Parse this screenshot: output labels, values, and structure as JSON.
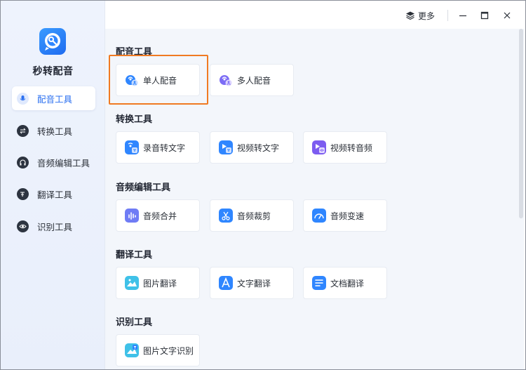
{
  "app": {
    "name": "秒转配音",
    "logo_icon": "microphone-chat-icon"
  },
  "titlebar": {
    "more_label": "更多",
    "more_icon": "layers-icon",
    "minimize_icon": "minimize-icon",
    "maximize_icon": "maximize-icon",
    "close_icon": "close-icon"
  },
  "sidebar": {
    "items": [
      {
        "label": "配音工具",
        "icon": "microphone-icon",
        "active": true
      },
      {
        "label": "转换工具",
        "icon": "swap-icon",
        "active": false
      },
      {
        "label": "音频编辑工具",
        "icon": "headphones-icon",
        "active": false
      },
      {
        "label": "翻译工具",
        "icon": "translate-icon",
        "active": false
      },
      {
        "label": "识别工具",
        "icon": "eye-icon",
        "active": false
      }
    ]
  },
  "sections": [
    {
      "title": "配音工具",
      "cards": [
        {
          "label": "单人配音",
          "icon": "single-voice-icon"
        },
        {
          "label": "多人配音",
          "icon": "multi-voice-icon"
        }
      ]
    },
    {
      "title": "转换工具",
      "cards": [
        {
          "label": "录音转文字",
          "icon": "audio-to-text-icon"
        },
        {
          "label": "视频转文字",
          "icon": "video-to-text-icon"
        },
        {
          "label": "视频转音频",
          "icon": "video-to-audio-icon"
        }
      ]
    },
    {
      "title": "音频编辑工具",
      "cards": [
        {
          "label": "音频合并",
          "icon": "audio-merge-icon"
        },
        {
          "label": "音频裁剪",
          "icon": "audio-cut-icon"
        },
        {
          "label": "音频变速",
          "icon": "audio-speed-icon"
        }
      ]
    },
    {
      "title": "翻译工具",
      "cards": [
        {
          "label": "图片翻译",
          "icon": "image-translate-icon"
        },
        {
          "label": "文字翻译",
          "icon": "text-translate-icon"
        },
        {
          "label": "文档翻译",
          "icon": "document-translate-icon"
        }
      ]
    },
    {
      "title": "识别工具",
      "cards": [
        {
          "label": "图片文字识别",
          "icon": "image-ocr-icon"
        }
      ]
    }
  ],
  "colors": {
    "accent": "#2a6ff0",
    "highlight_border": "#f07a22",
    "sidebar_bg": "#eef3fd",
    "content_bg": "#f3f6fb"
  }
}
